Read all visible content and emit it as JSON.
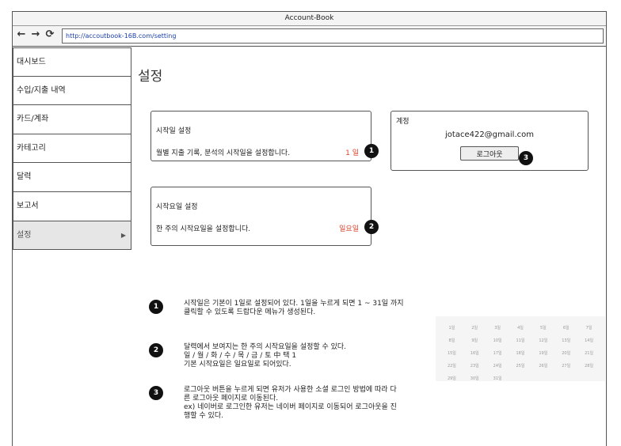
{
  "window": {
    "title": "Account-Book"
  },
  "browser": {
    "url": "http://accoutbook-16B.com/setting",
    "back_icon": "←",
    "forward_icon": "→",
    "reload_icon": "⟳"
  },
  "sidebar": {
    "items": [
      {
        "label": "대시보드"
      },
      {
        "label": "수입/지출 내역"
      },
      {
        "label": "카드/계좌"
      },
      {
        "label": "카테고리"
      },
      {
        "label": "달력"
      },
      {
        "label": "보고서"
      },
      {
        "label": "설정",
        "arrow": "▶"
      }
    ]
  },
  "page": {
    "title": "설정"
  },
  "start_day": {
    "title": "시작일 설정",
    "description": "월별 지출 기록, 분석의 시작일을 설정합니다.",
    "value": "1 일",
    "badge": "1"
  },
  "start_weekday": {
    "title": "시작요일 설정",
    "description": "한 주의 시작요일을 설정합니다.",
    "value": "일요일",
    "badge": "2"
  },
  "account": {
    "title": "계정",
    "email": "jotace422@gmail.com",
    "logout_label": "로그아웃",
    "badge": "3"
  },
  "notes": [
    {
      "badge": "1",
      "text": "시작일은 기본이 1일로 설정되어 있다. 1일을 누르게 되면 1 ~ 31일 까지\n클릭할 수 있도록 드랍다운 메뉴가 생성된다."
    },
    {
      "badge": "2",
      "text": "달력에서 보여지는 한 주의 시작요일을 설정할 수 있다.\n일 / 월 / 화 / 수 / 목 / 금 / 토 中 택 1\n기본 시작요일은 일요일로 되어있다."
    },
    {
      "badge": "3",
      "text": "로그아웃 버튼을 누르게 되면 유저가 사용한 소셜 로그인 방법에 따라 다\n른 로그아웃 페이지로 이동된다.\nex) 네이버로 로그인한 유저는 네이버 페이지로 이동되어 로그아웃을 진\n행할 수 있다."
    }
  ],
  "calendar": {
    "days": [
      "1일",
      "2일",
      "3일",
      "4일",
      "5일",
      "6일",
      "7일",
      "8일",
      "9일",
      "10일",
      "11일",
      "12일",
      "13일",
      "14일",
      "15일",
      "16일",
      "17일",
      "18일",
      "19일",
      "20일",
      "21일",
      "22일",
      "23일",
      "24일",
      "25일",
      "26일",
      "27일",
      "28일",
      "29일",
      "30일",
      "31일"
    ]
  }
}
